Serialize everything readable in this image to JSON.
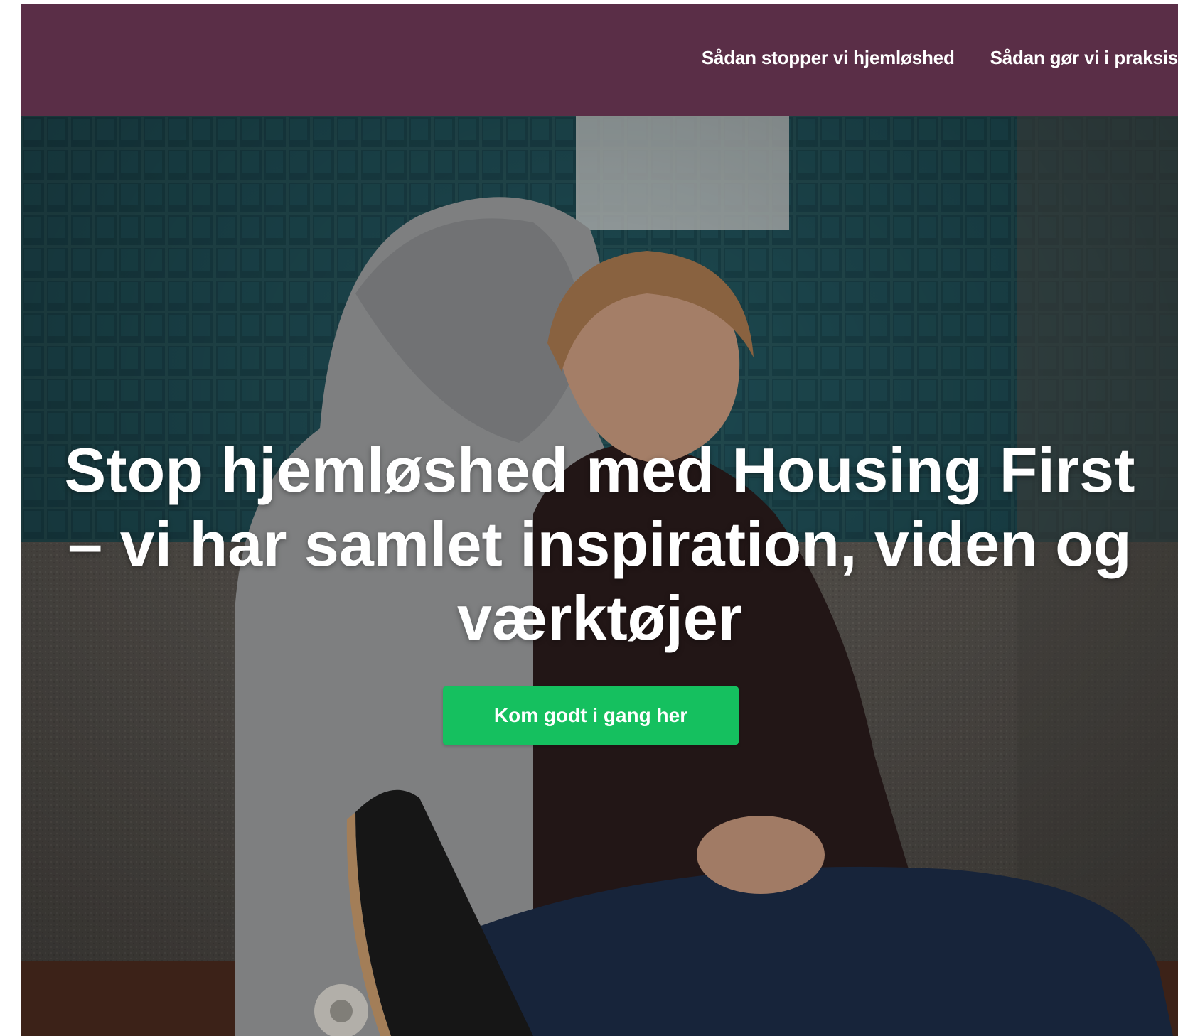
{
  "header": {
    "nav": [
      {
        "label": "Sådan stopper vi hjemløshed"
      },
      {
        "label": "Sådan gør vi i praksis"
      }
    ],
    "background_color": "#5a2e47"
  },
  "hero": {
    "headline": "Stop hjemløshed med Housing First – vi har samlet inspiration, viden og værktøjer",
    "cta_label": "Kom godt i gang her",
    "cta_color": "#15c05f"
  }
}
